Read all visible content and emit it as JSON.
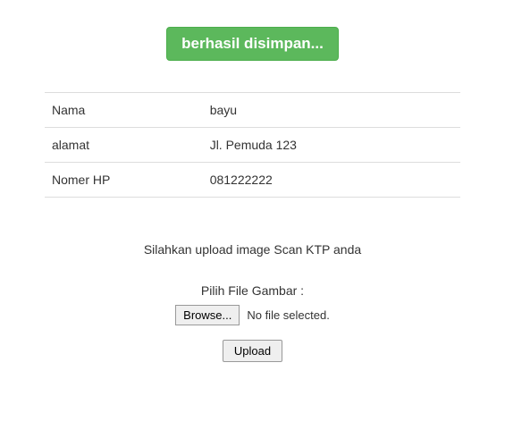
{
  "alert": {
    "message": "berhasil disimpan..."
  },
  "table": {
    "rows": [
      {
        "label": "Nama",
        "value": "bayu"
      },
      {
        "label": "alamat",
        "value": "Jl. Pemuda 123"
      },
      {
        "label": "Nomer HP",
        "value": "081222222"
      }
    ]
  },
  "upload": {
    "title": "Silahkan upload image Scan KTP anda",
    "file_label": "Pilih File Gambar :",
    "browse_button": "Browse...",
    "file_status": "No file selected.",
    "submit_button": "Upload"
  }
}
